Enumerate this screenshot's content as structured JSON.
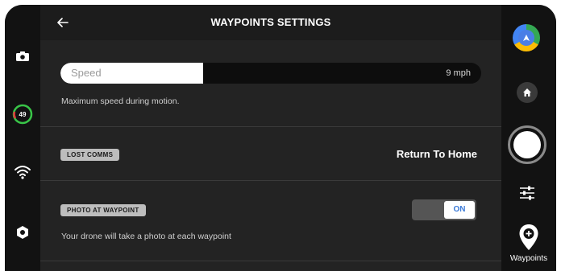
{
  "header": {
    "title": "WAYPOINTS SETTINGS"
  },
  "left_rail": {
    "battery_level": "49"
  },
  "speed": {
    "label": "Speed",
    "value": "9 mph",
    "fill_fraction": 0.34,
    "description": "Maximum speed during motion."
  },
  "lost_comms": {
    "tag": "LOST COMMS",
    "value": "Return To Home"
  },
  "photo_at_waypoint": {
    "tag": "PHOTO AT WAYPOINT",
    "toggle_label": "ON",
    "description": "Your drone will take a photo at each waypoint"
  },
  "right_rail": {
    "waypoints_label": "Waypoints"
  },
  "colors": {
    "accent": "#3c7bd8",
    "battery_ring": "#39c548",
    "battery_ring_low": "#e23a3a"
  }
}
